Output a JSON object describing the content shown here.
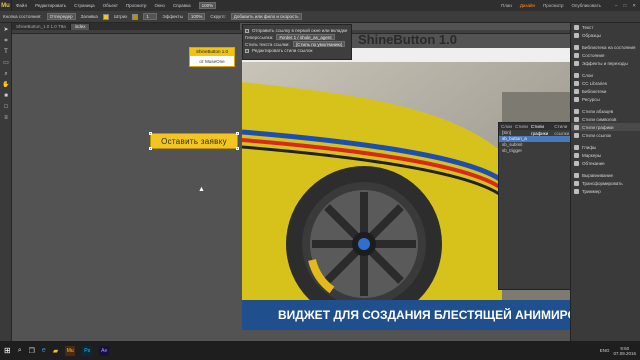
{
  "menubar": {
    "logo": "Mu",
    "items": [
      "Файл",
      "Редактировать",
      "Страница",
      "Объект",
      "Просмотр",
      "Окно",
      "Справка"
    ],
    "zoom": "100%",
    "workspaces": [
      "План",
      "Дизайн",
      "Просмотр",
      "Опубликовать"
    ],
    "active_workspace": "Дизайн"
  },
  "toolbar": {
    "label_state": "Кнопка состояния:",
    "state_value": "Отпередер",
    "fill": "Заливка",
    "stroke": "Штрих",
    "stroke_value": "1",
    "effect": "Эффекты",
    "opacity": "100%",
    "corners": "Скругл:",
    "text_placeholder": "Добавить или фило и скорость"
  },
  "tabs": [
    "ShineButton_1.0 1.0 T8a",
    "index"
  ],
  "widget": {
    "title": "ShineButton 1.0",
    "subtitle": "от MuseOne"
  },
  "order_button": {
    "label": "Оставить заявку"
  },
  "photo": {
    "title": "ShineButton 1.0",
    "banner": "ВИДЖЕТ ДЛЯ СОЗДАНИЯ БЛЕСТЯЩЕЙ АНИМИРОВА"
  },
  "link_popup": {
    "option1": "Отправить ссылку в первой окне или вкладке",
    "label_hyperlink": "Гиперссылка:",
    "hyperlink_value": "#order 1 / shule_as_agent",
    "label_style": "Стиль текста ссылки:",
    "style_value": "(Стиль по умолчанию)",
    "option2": "Редактировать стили ссылок"
  },
  "states_panel": {
    "tabs": [
      "Слои",
      "Стили",
      "Стили графики",
      "Стили ссылки"
    ],
    "rows": [
      "[Sin]",
      "sb_button_a",
      "sb_submit",
      "sb_trigger"
    ],
    "selected": 1
  },
  "right_panel": {
    "groups": [
      [
        "Текст",
        "Образцы"
      ],
      [
        "Библиотека на состояния",
        "Состояния",
        "Эффекты и переходы"
      ],
      [
        "Слои",
        "CC Libraries",
        "Библиотеки",
        "Ресурсы"
      ],
      [
        "Стили абзацев",
        "Стили символов",
        "Стили графики",
        "Стили ссылок"
      ],
      [
        "Глифы",
        "Маркеры",
        "Обтекание"
      ],
      [
        "Выравнивание",
        "Трансформировать",
        "Триммер"
      ]
    ],
    "active": "Стили графики"
  },
  "taskbar": {
    "time": "9:50",
    "date": "07.09.2016",
    "lang": "ENG",
    "apps": [
      "Mu",
      "Ps",
      "Ae"
    ]
  }
}
